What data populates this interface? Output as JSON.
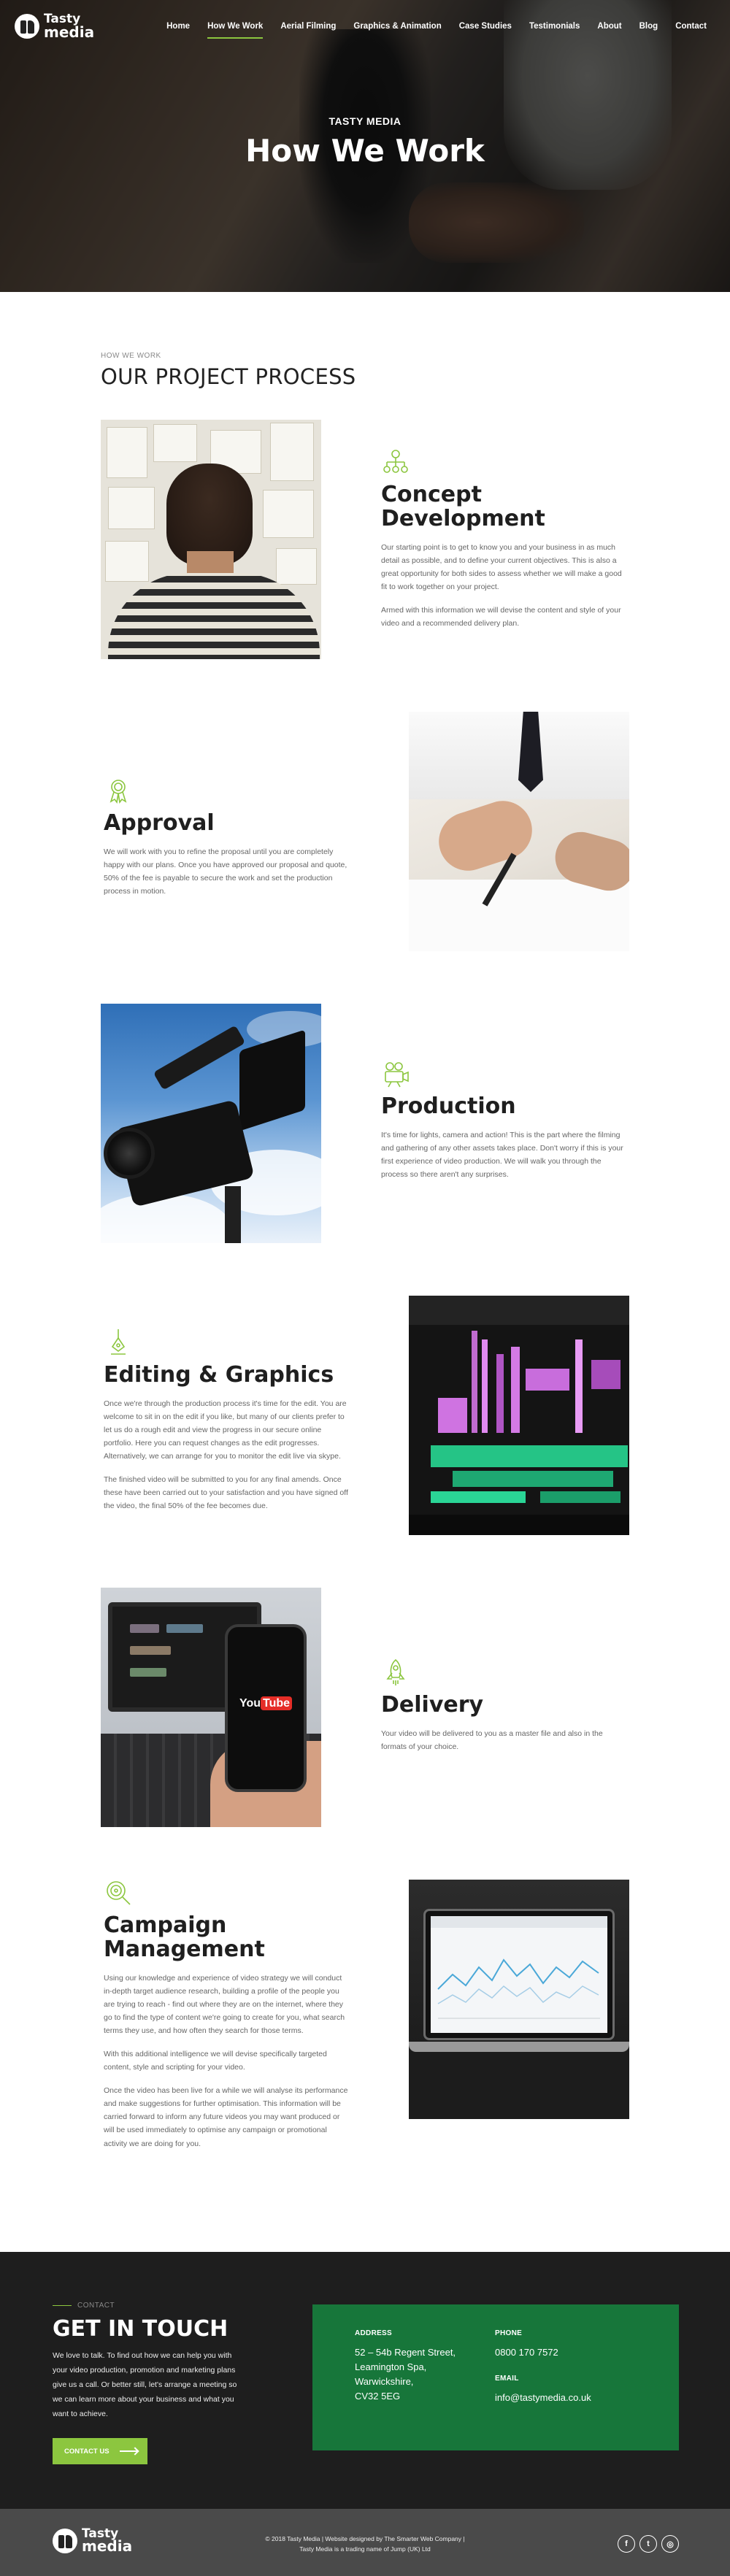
{
  "brand": {
    "line1": "Tasty",
    "line2": "media"
  },
  "nav": {
    "items": [
      {
        "label": "Home"
      },
      {
        "label": "How We Work"
      },
      {
        "label": "Aerial Filming"
      },
      {
        "label": "Graphics & Animation"
      },
      {
        "label": "Case Studies"
      },
      {
        "label": "Testimonials"
      },
      {
        "label": "About"
      },
      {
        "label": "Blog"
      },
      {
        "label": "Contact"
      }
    ],
    "active": "How We Work",
    "accent": "#8cc63f"
  },
  "hero": {
    "kicker": "TASTY MEDIA",
    "title": "How We Work"
  },
  "process": {
    "kicker": "HOW WE WORK",
    "title": "OUR PROJECT PROCESS"
  },
  "steps": [
    {
      "title": "Concept Development",
      "icon": "lightbulb-network-icon",
      "paragraphs": [
        "Our starting point is to get to know you and your business in as much detail as possible, and to define your current objectives. This is also a great opportunity for both sides to assess whether we will make a good fit to work together on your project.",
        "Armed with this information we will devise the content and style of your video and a recommended delivery plan."
      ]
    },
    {
      "title": "Approval",
      "icon": "award-icon",
      "paragraphs": [
        "We will work with you to refine the proposal until you are completely happy with our plans. Once you have approved our proposal and quote, 50% of the fee is payable to secure the work and set the production process in motion."
      ]
    },
    {
      "title": "Production",
      "icon": "camera-icon",
      "paragraphs": [
        "It's time for lights, camera and action! This is the part where the filming and gathering of any other assets takes place. Don't worry if this is your first experience of video production. We will walk you through the process so there aren't any surprises."
      ]
    },
    {
      "title": "Editing & Graphics",
      "icon": "pen-tool-icon",
      "paragraphs": [
        "Once we're through the production process it's time for the edit. You are welcome to sit in on the edit if you like, but many of our clients prefer to let us do a rough edit and view the progress in our secure online portfolio. Here you can request changes as the edit progresses. Alternatively, we can arrange for you to monitor the edit live via skype.",
        "The finished video will be submitted to you for any final amends. Once these have been carried out to your satisfaction and you have signed off the video, the final 50% of the fee becomes due."
      ]
    },
    {
      "title": "Delivery",
      "icon": "rocket-icon",
      "paragraphs": [
        "Your video will be delivered to you as a master file and also in the formats of your choice."
      ]
    },
    {
      "title": "Campaign Management",
      "icon": "target-search-icon",
      "paragraphs": [
        "Using our knowledge and experience of video strategy we will conduct in-depth target audience research, building a profile of the people you are trying to reach - find out where they are on the internet, where they go to find the type of content we're going to create for you, what search terms they use, and how often they search for those terms.",
        "With this additional intelligence we will devise specifically targeted content, style and scripting for your video.",
        "Once the video has been live for a while we will analyse its performance and make suggestions for further optimisation. This information will be carried forward to inform any future videos you may want produced or will be used immediately to optimise any campaign or promotional activity we are doing for you."
      ]
    }
  ],
  "contact": {
    "kicker": "CONTACT",
    "title": "GET IN TOUCH",
    "text": "We love to talk. To find out how we can help you with your video production, promotion and marketing plans give us a call. Or better still, let's arrange a meeting so we can learn more about your business and what you want to achieve.",
    "button": "CONTACT US",
    "address_label": "ADDRESS",
    "address": [
      "52 – 54b Regent Street,",
      "Leamington Spa,",
      "Warwickshire,",
      "CV32 5EG"
    ],
    "phone_label": "PHONE",
    "phone": "0800 170 7572",
    "email_label": "EMAIL",
    "email": "info@tastymedia.co.uk",
    "box_color": "#17763a"
  },
  "footer": {
    "copy1": "© 2018 Tasty Media | Website designed by The Smarter Web Company |",
    "copy2": "Tasty Media is a trading name of Jump (UK) Ltd",
    "socials": [
      {
        "icon": "facebook-icon",
        "glyph": "f"
      },
      {
        "icon": "twitter-icon",
        "glyph": "t"
      },
      {
        "icon": "instagram-icon",
        "glyph": "◎"
      }
    ]
  }
}
